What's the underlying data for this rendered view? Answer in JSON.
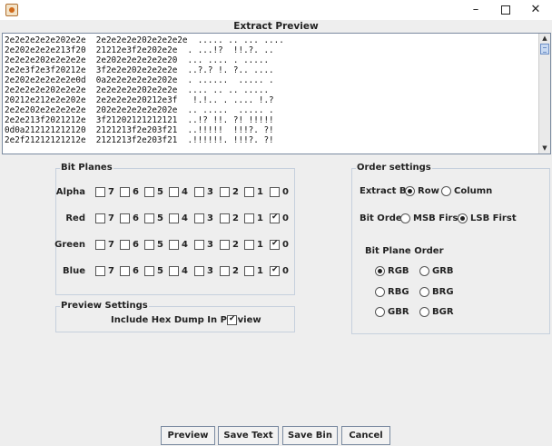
{
  "window": {
    "title": "Extract Preview",
    "minimize": "–",
    "close": "✕"
  },
  "preview_lines": [
    "2e2e2e2e2e202e2e  2e2e2e2e202e2e2e2e  ..... .. ... ....",
    "2e202e2e2e213f20  21212e3f2e202e2e  . ...!?  !!.?. ..",
    "2e2e2e202e2e2e2e  2e202e2e2e2e2e20  ... .... . .....",
    "2e2e3f2e3f20212e  3f2e2e202e2e2e2e  ..?.? !. ?.. ....",
    "2e202e2e2e2e2e0d  0a2e2e2e2e2e202e  . ......  ..... .",
    "2e2e2e2e202e2e2e  2e2e2e2e202e2e2e  .... .. .. .....",
    "20212e212e2e202e  2e2e2e2e20212e3f   !.!.. . .... !.?",
    "2e2e202e2e2e2e2e  202e2e2e2e2e202e  .. .....  ..... .",
    "2e2e213f2021212e  3f21202121212121  ..!? !!. ?! !!!!!",
    "0d0a212121212120  2121213f2e203f21  ..!!!!!  !!!?. ?!",
    "2e2f21212121212e  2121213f2e203f21  .!!!!!!. !!!?. ?!"
  ],
  "bit_planes": {
    "title": "Bit Planes",
    "bit_labels": [
      "7",
      "6",
      "5",
      "4",
      "3",
      "2",
      "1",
      "0"
    ],
    "rows": [
      {
        "label": "Alpha",
        "checked": [
          false,
          false,
          false,
          false,
          false,
          false,
          false,
          false
        ]
      },
      {
        "label": "Red",
        "checked": [
          false,
          false,
          false,
          false,
          false,
          false,
          false,
          true
        ]
      },
      {
        "label": "Green",
        "checked": [
          false,
          false,
          false,
          false,
          false,
          false,
          false,
          true
        ]
      },
      {
        "label": "Blue",
        "checked": [
          false,
          false,
          false,
          false,
          false,
          false,
          false,
          true
        ]
      }
    ]
  },
  "preview_settings": {
    "title": "Preview Settings",
    "hex_dump_label": "Include Hex Dump In Preview",
    "hex_dump_checked": true
  },
  "order_settings": {
    "title": "Order settings",
    "extract_by_label": "Extract By",
    "extract_by_options": [
      "Row",
      "Column"
    ],
    "extract_by_selected": "Row",
    "bit_order_label": "Bit Order",
    "bit_order_options": [
      "MSB First",
      "LSB First"
    ],
    "bit_order_selected": "LSB First",
    "bit_plane_order_label": "Bit Plane Order",
    "bit_plane_order_options": [
      "RGB",
      "GRB",
      "RBG",
      "BRG",
      "GBR",
      "BGR"
    ],
    "bit_plane_order_selected": "RGB"
  },
  "buttons": {
    "preview": "Preview",
    "save_text": "Save Text",
    "save_bin": "Save Bin",
    "cancel": "Cancel"
  }
}
